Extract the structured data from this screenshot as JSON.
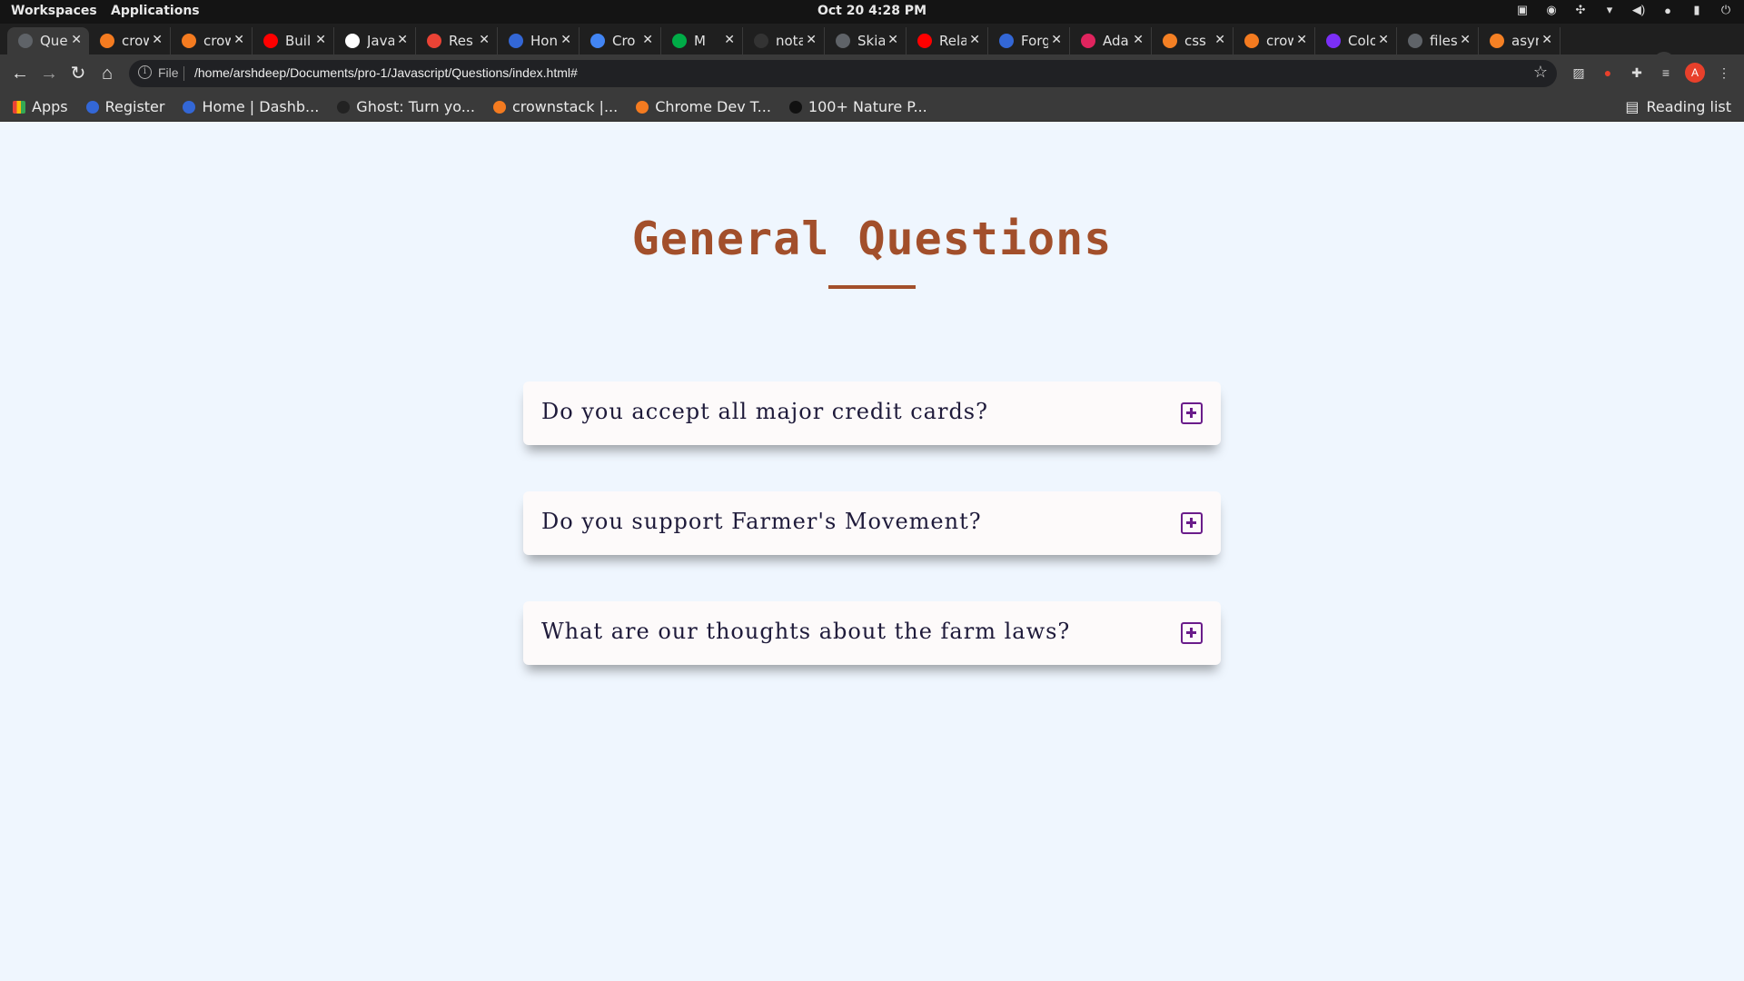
{
  "os_bar": {
    "workspaces": "Workspaces",
    "applications": "Applications",
    "clock": "Oct 20   4:28 PM"
  },
  "tabs": [
    {
      "title": "Que",
      "favicon_color": "#5f6368",
      "icon": "globe-icon"
    },
    {
      "title": "crow",
      "favicon_color": "#f47b20",
      "icon": "crownstack-icon"
    },
    {
      "title": "crow",
      "favicon_color": "#f47b20",
      "icon": "crownstack-icon"
    },
    {
      "title": "Buil",
      "favicon_color": "#ff0000",
      "icon": "youtube-icon"
    },
    {
      "title": "Java",
      "favicon_color": "#ffffff",
      "icon": "download-icon"
    },
    {
      "title": "Res",
      "favicon_color": "#ea4335",
      "icon": "gmail-icon"
    },
    {
      "title": "Hon",
      "favicon_color": "#3367d6",
      "icon": "k-icon"
    },
    {
      "title": "Cro",
      "favicon_color": "#4285f4",
      "icon": "calendar-icon"
    },
    {
      "title": "M",
      "favicon_color": "#00ac47",
      "icon": "meet-icon"
    },
    {
      "title": "nota",
      "favicon_color": "#333333",
      "icon": "github-icon"
    },
    {
      "title": "Skia",
      "favicon_color": "#5f6368",
      "icon": "globe-icon"
    },
    {
      "title": "Rela",
      "favicon_color": "#ff0000",
      "icon": "youtube-icon"
    },
    {
      "title": "Forg",
      "favicon_color": "#3367d6",
      "icon": "k-icon"
    },
    {
      "title": "Ada",
      "favicon_color": "#e0245e",
      "icon": "asterisk-icon"
    },
    {
      "title": "css",
      "favicon_color": "#f48024",
      "icon": "stackoverflow-icon"
    },
    {
      "title": "crow",
      "favicon_color": "#f47b20",
      "icon": "crownstack-icon"
    },
    {
      "title": "Colo",
      "favicon_color": "#7b2ff7",
      "icon": "c-icon"
    },
    {
      "title": "files",
      "favicon_color": "#5f6368",
      "icon": "globe-icon"
    },
    {
      "title": "asyn",
      "favicon_color": "#f48024",
      "icon": "stackoverflow-icon"
    }
  ],
  "toolbar": {
    "scheme": "File",
    "url": "/home/arshdeep/Documents/pro-1/Javascript/Questions/index.html#",
    "avatar_letter": "A"
  },
  "bookmarks": [
    {
      "label": "Apps",
      "color": "#e8e8e8",
      "icon": "apps-grid-icon"
    },
    {
      "label": "Register",
      "color": "#3367d6",
      "icon": "k-icon"
    },
    {
      "label": "Home | Dashb...",
      "color": "#3367d6",
      "icon": "k-icon"
    },
    {
      "label": "Ghost: Turn yo...",
      "color": "#222222",
      "icon": "ghost-icon"
    },
    {
      "label": "crownstack |...",
      "color": "#f47b20",
      "icon": "crownstack-icon"
    },
    {
      "label": "Chrome Dev T...",
      "color": "#f47b20",
      "icon": "crownstack-icon"
    },
    {
      "label": "100+ Nature P...",
      "color": "#111111",
      "icon": "unsplash-icon"
    }
  ],
  "reading_list": "Reading list",
  "page": {
    "title": "General Questions",
    "accent_color": "#a24f2b",
    "questions": [
      {
        "text": "Do you accept all major credit cards?"
      },
      {
        "text": "Do you support Farmer's Movement?"
      },
      {
        "text": "What are our thoughts about the farm laws?"
      }
    ]
  }
}
